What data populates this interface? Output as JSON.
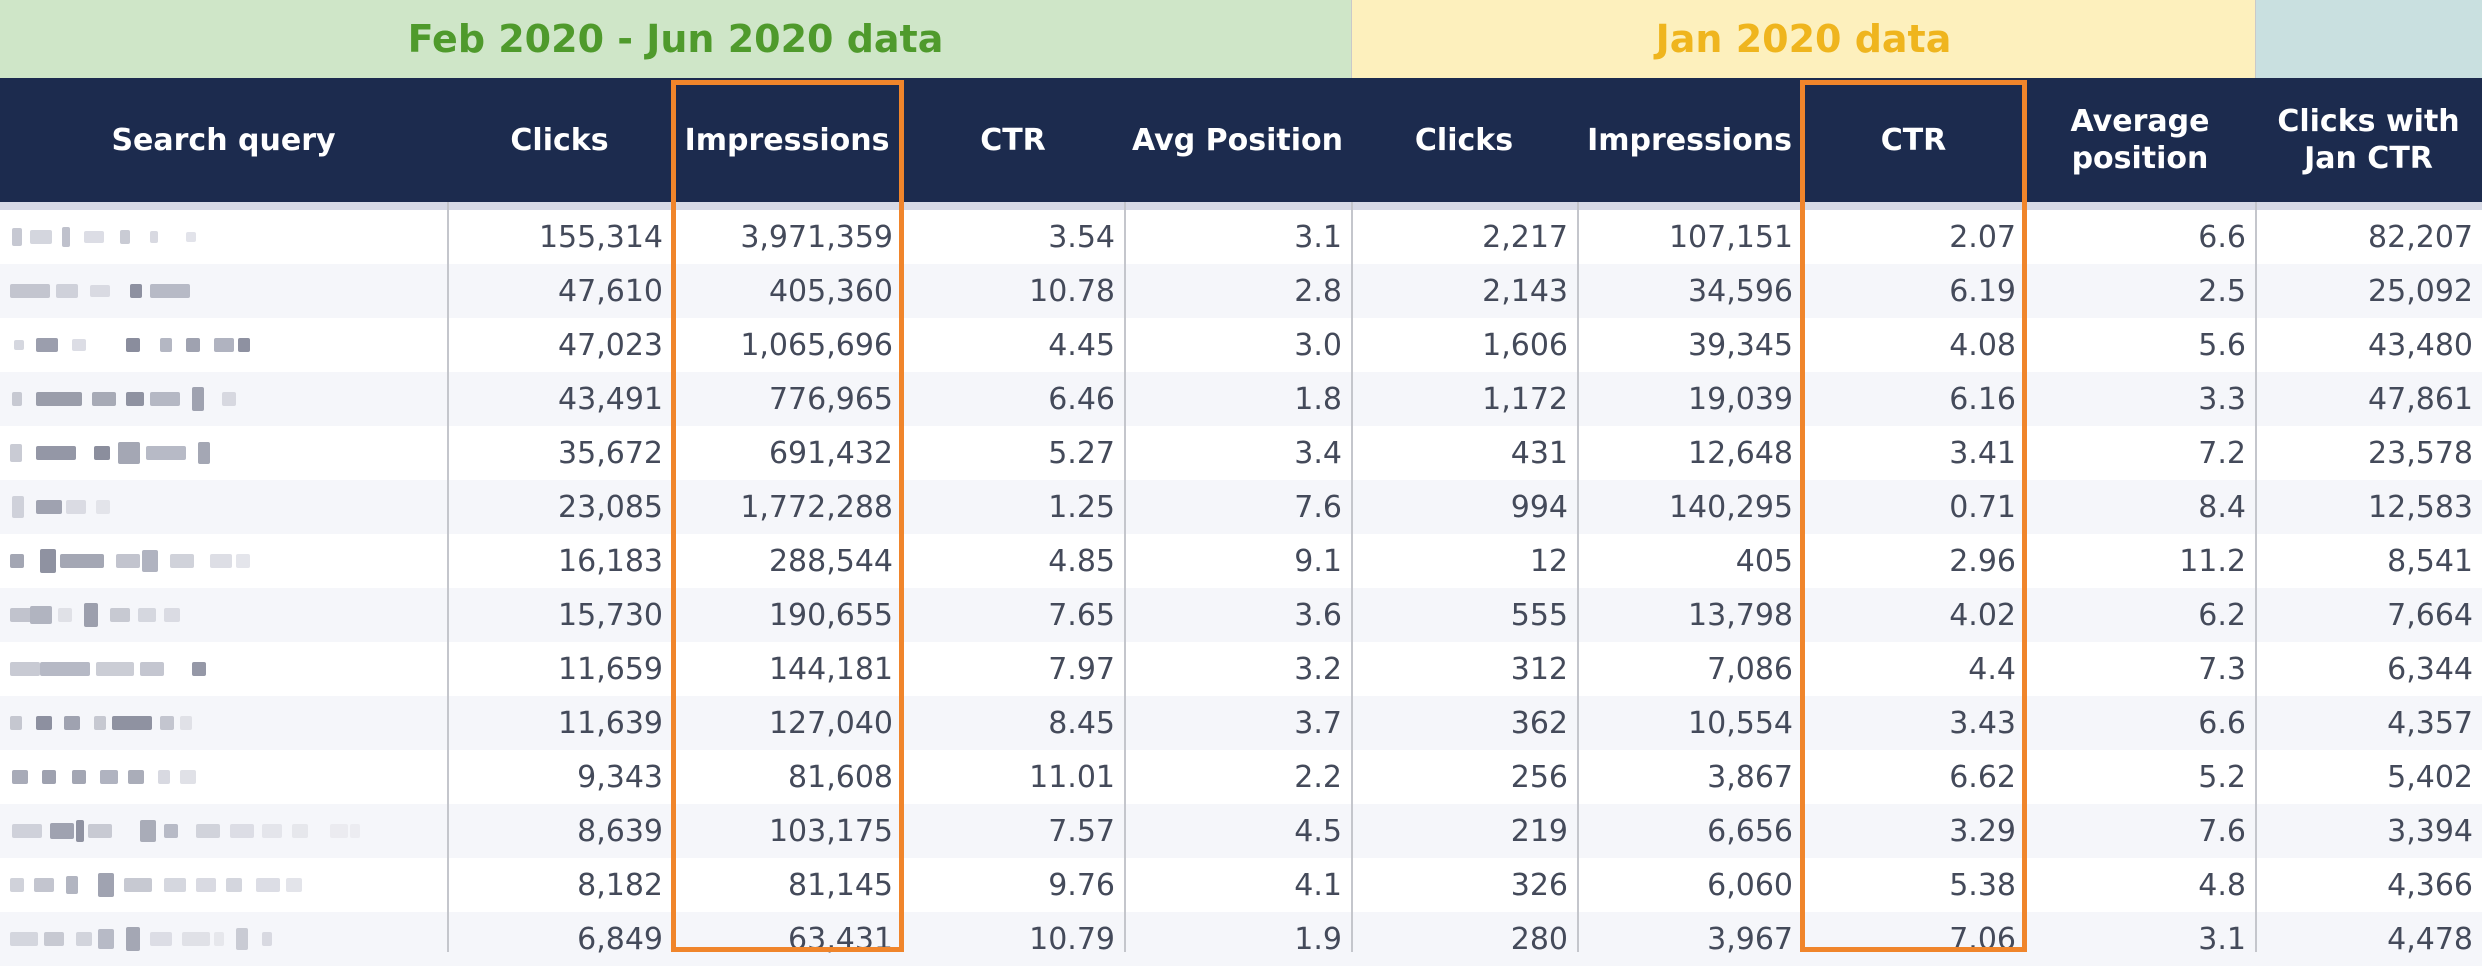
{
  "groups": {
    "feb_jun": "Feb 2020 - Jun 2020 data",
    "jan": "Jan 2020 data"
  },
  "columns": {
    "query": "Search query",
    "clicks": "Clicks",
    "impressions": "Impressions",
    "ctr": "CTR",
    "avg_position": "Avg Position",
    "jan_clicks": "Clicks",
    "jan_impressions": "Impressions",
    "jan_ctr": "CTR",
    "jan_avg_position": "Average\nposition",
    "clicks_jan_ctr": "Clicks with\nJan CTR"
  },
  "highlight_color": "#f0852b",
  "rows": [
    {
      "clicks": "155,314",
      "impressions": "3,971,359",
      "ctr": "3.54",
      "avg_position": "3.1",
      "jan_clicks": "2,217",
      "jan_impressions": "107,151",
      "jan_ctr": "2.07",
      "jan_avg_position": "6.6",
      "clicks_jan_ctr": "82,207"
    },
    {
      "clicks": "47,610",
      "impressions": "405,360",
      "ctr": "10.78",
      "avg_position": "2.8",
      "jan_clicks": "2,143",
      "jan_impressions": "34,596",
      "jan_ctr": "6.19",
      "jan_avg_position": "2.5",
      "clicks_jan_ctr": "25,092"
    },
    {
      "clicks": "47,023",
      "impressions": "1,065,696",
      "ctr": "4.45",
      "avg_position": "3.0",
      "jan_clicks": "1,606",
      "jan_impressions": "39,345",
      "jan_ctr": "4.08",
      "jan_avg_position": "5.6",
      "clicks_jan_ctr": "43,480"
    },
    {
      "clicks": "43,491",
      "impressions": "776,965",
      "ctr": "6.46",
      "avg_position": "1.8",
      "jan_clicks": "1,172",
      "jan_impressions": "19,039",
      "jan_ctr": "6.16",
      "jan_avg_position": "3.3",
      "clicks_jan_ctr": "47,861"
    },
    {
      "clicks": "35,672",
      "impressions": "691,432",
      "ctr": "5.27",
      "avg_position": "3.4",
      "jan_clicks": "431",
      "jan_impressions": "12,648",
      "jan_ctr": "3.41",
      "jan_avg_position": "7.2",
      "clicks_jan_ctr": "23,578"
    },
    {
      "clicks": "23,085",
      "impressions": "1,772,288",
      "ctr": "1.25",
      "avg_position": "7.6",
      "jan_clicks": "994",
      "jan_impressions": "140,295",
      "jan_ctr": "0.71",
      "jan_avg_position": "8.4",
      "clicks_jan_ctr": "12,583"
    },
    {
      "clicks": "16,183",
      "impressions": "288,544",
      "ctr": "4.85",
      "avg_position": "9.1",
      "jan_clicks": "12",
      "jan_impressions": "405",
      "jan_ctr": "2.96",
      "jan_avg_position": "11.2",
      "clicks_jan_ctr": "8,541"
    },
    {
      "clicks": "15,730",
      "impressions": "190,655",
      "ctr": "7.65",
      "avg_position": "3.6",
      "jan_clicks": "555",
      "jan_impressions": "13,798",
      "jan_ctr": "4.02",
      "jan_avg_position": "6.2",
      "clicks_jan_ctr": "7,664"
    },
    {
      "clicks": "11,659",
      "impressions": "144,181",
      "ctr": "7.97",
      "avg_position": "3.2",
      "jan_clicks": "312",
      "jan_impressions": "7,086",
      "jan_ctr": "4.4",
      "jan_avg_position": "7.3",
      "clicks_jan_ctr": "6,344"
    },
    {
      "clicks": "11,639",
      "impressions": "127,040",
      "ctr": "8.45",
      "avg_position": "3.7",
      "jan_clicks": "362",
      "jan_impressions": "10,554",
      "jan_ctr": "3.43",
      "jan_avg_position": "6.6",
      "clicks_jan_ctr": "4,357"
    },
    {
      "clicks": "9,343",
      "impressions": "81,608",
      "ctr": "11.01",
      "avg_position": "2.2",
      "jan_clicks": "256",
      "jan_impressions": "3,867",
      "jan_ctr": "6.62",
      "jan_avg_position": "5.2",
      "clicks_jan_ctr": "5,402"
    },
    {
      "clicks": "8,639",
      "impressions": "103,175",
      "ctr": "7.57",
      "avg_position": "4.5",
      "jan_clicks": "219",
      "jan_impressions": "6,656",
      "jan_ctr": "3.29",
      "jan_avg_position": "7.6",
      "clicks_jan_ctr": "3,394"
    },
    {
      "clicks": "8,182",
      "impressions": "81,145",
      "ctr": "9.76",
      "avg_position": "4.1",
      "jan_clicks": "326",
      "jan_impressions": "6,060",
      "jan_ctr": "5.38",
      "jan_avg_position": "4.8",
      "clicks_jan_ctr": "4,366"
    },
    {
      "clicks": "6,849",
      "impressions": "63,431",
      "ctr": "10.79",
      "avg_position": "1.9",
      "jan_clicks": "280",
      "jan_impressions": "3,967",
      "jan_ctr": "7.06",
      "jan_avg_position": "3.1",
      "clicks_jan_ctr": "4,478"
    }
  ]
}
